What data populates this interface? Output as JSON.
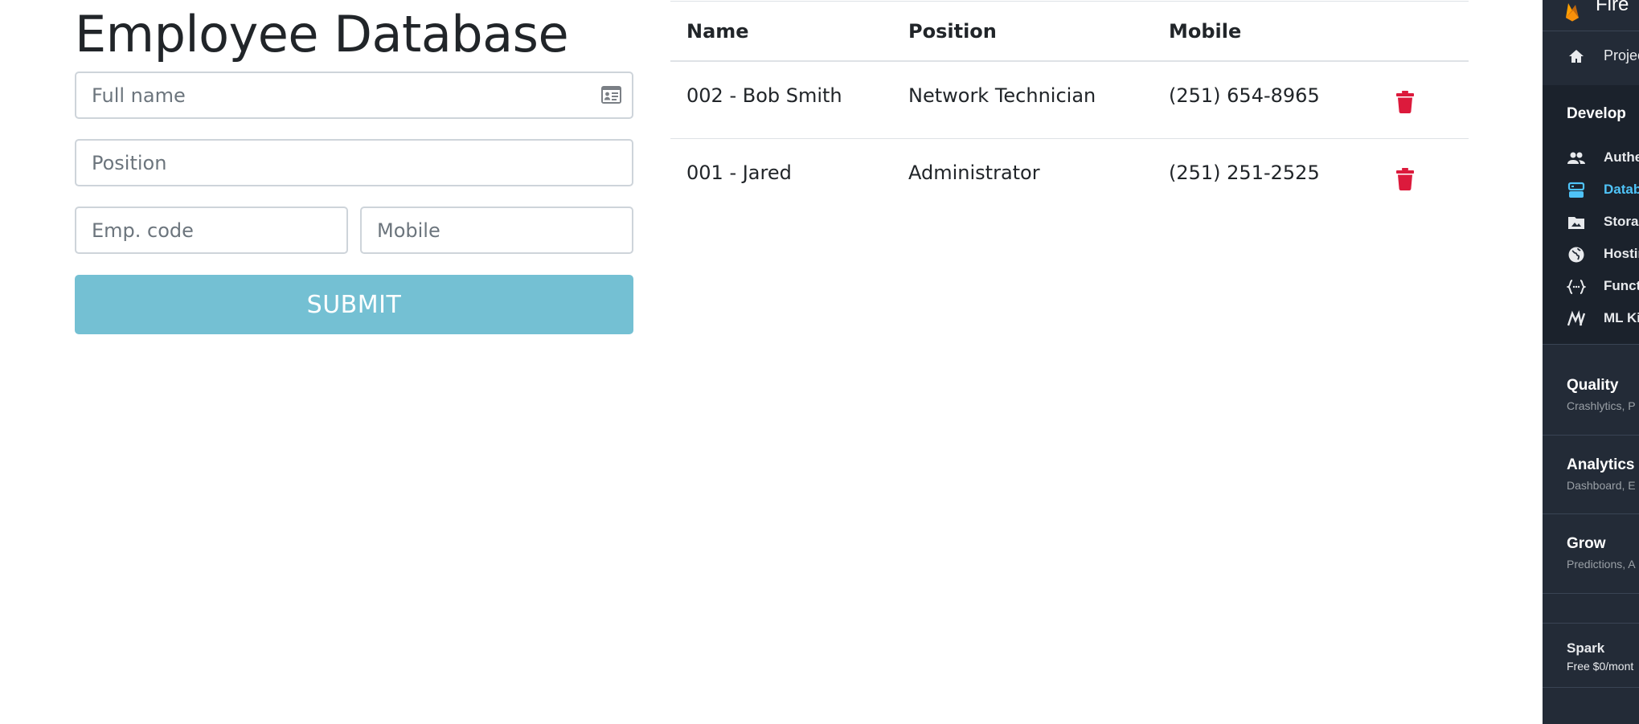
{
  "form": {
    "title": "Employee Database",
    "full_name_placeholder": "Full name",
    "position_placeholder": "Position",
    "emp_code_placeholder": "Emp. code",
    "mobile_placeholder": "Mobile",
    "submit_label": "SUBMIT"
  },
  "table": {
    "headers": [
      "Name",
      "Position",
      "Mobile"
    ],
    "rows": [
      {
        "name": "002 - Bob Smith",
        "position": "Network Technician",
        "mobile": "(251) 654-8965"
      },
      {
        "name": "001 - Jared",
        "position": "Administrator",
        "mobile": "(251) 251-2525"
      }
    ]
  },
  "sidebar": {
    "brand": "Fire",
    "project_label": "Projec",
    "develop": {
      "heading": "Develop",
      "items": [
        {
          "label": "Authe",
          "icon": "people-icon"
        },
        {
          "label": "Datab",
          "icon": "database-icon",
          "active": true
        },
        {
          "label": "Storag",
          "icon": "folder-icon"
        },
        {
          "label": "Hostin",
          "icon": "globe-icon"
        },
        {
          "label": "Funct",
          "icon": "functions-icon"
        },
        {
          "label": "ML Ki",
          "icon": "ml-kit-icon"
        }
      ]
    },
    "quality": {
      "heading": "Quality",
      "sub": "Crashlytics, P"
    },
    "analytics": {
      "heading": "Analytics",
      "sub": "Dashboard, E"
    },
    "grow": {
      "heading": "Grow",
      "sub": "Predictions, A"
    },
    "plan": {
      "name": "Spark",
      "price": "Free $0/mont"
    }
  },
  "colors": {
    "submit": "#74c0d3",
    "delete": "#dc1a3c",
    "sidebar_bg": "#232b37",
    "sidebar_active": "#4fc3f7"
  }
}
